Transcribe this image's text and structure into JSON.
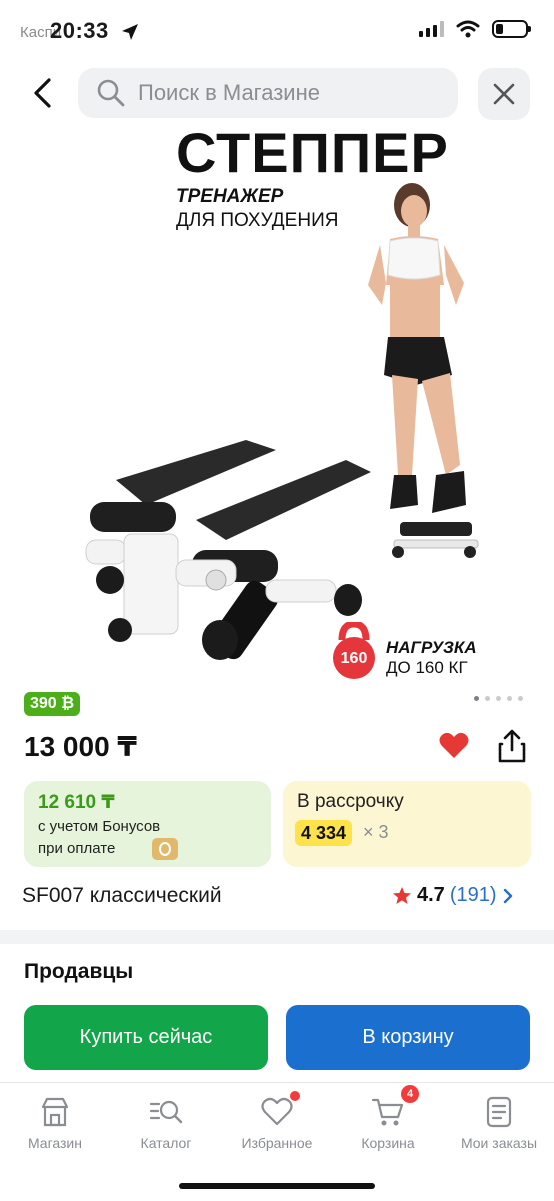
{
  "status": {
    "time": "20:33",
    "back_app": "Каспи"
  },
  "search": {
    "placeholder": "Поиск в Магазине"
  },
  "product_image": {
    "title": "СТЕППЕР",
    "subtitle_bold": "ТРЕНАЖЕР",
    "subtitle": "ДЛЯ ПОХУДЕНИЯ",
    "load_label": "НАГРУЗКА",
    "load_value": "ДО 160 КГ",
    "kettlebell_number": "160",
    "gallery_dots": 5,
    "active_dot": 0
  },
  "product": {
    "bonus_badge": "390 ₿",
    "price": "13 000 ₸",
    "bonus_card": {
      "amount": "12 610 ₸",
      "line1": "с учетом Бонусов",
      "line2": "при оплате"
    },
    "installment_card": {
      "title": "В рассрочку",
      "payment": "4 334",
      "multiplier": "× 3"
    },
    "model": "SF007 классический",
    "rating": "4.7",
    "reviews": "(191)"
  },
  "sellers": {
    "title": "Продавцы",
    "buy_now": "Купить сейчас",
    "add_to_cart": "В корзину"
  },
  "tabs": [
    {
      "label": "Магазин",
      "icon": "store-icon"
    },
    {
      "label": "Каталог",
      "icon": "catalog-search-icon"
    },
    {
      "label": "Избранное",
      "icon": "heart-outline-icon"
    },
    {
      "label": "Корзина",
      "icon": "cart-icon",
      "badge": "4"
    },
    {
      "label": "Мои заказы",
      "icon": "orders-icon"
    }
  ],
  "colors": {
    "buy_now": "#13a549",
    "to_cart": "#1a6fcf",
    "favorite": "#e53935",
    "accent_link": "#2a6fc9",
    "bonus_badge": "#4caf1a",
    "installment_highlight": "#fde24a"
  }
}
